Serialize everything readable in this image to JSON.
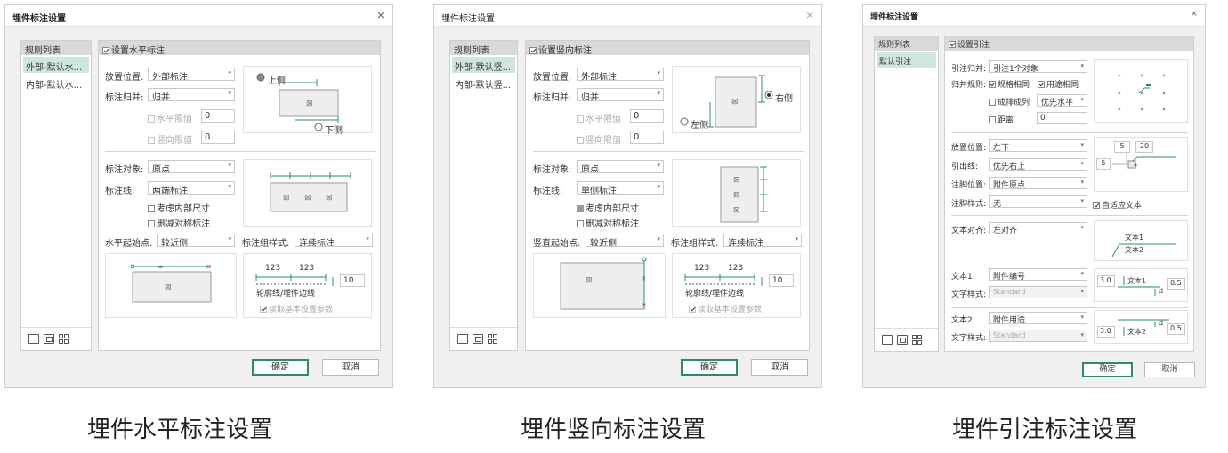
{
  "dialogs": [
    {
      "title": "埋件标注设置",
      "close": "×",
      "rules_header": "规则列表",
      "rules": [
        "外部-默认水...",
        "内部-默认水..."
      ],
      "section_check": "设置水平标注",
      "placement_label": "放置位置:",
      "placement_value": "外部标注",
      "merge_label": "标注归并:",
      "merge_value": "归并",
      "h_limit_label": "水平限值",
      "h_limit_value": "0",
      "v_limit_label": "竖向限值",
      "v_limit_value": "0",
      "side_a": "上侧",
      "side_b": "下侧",
      "target_label": "标注对象:",
      "target_value": "原点",
      "line_label": "标注线:",
      "line_value": "两端标注",
      "inner_dim": "考虑内部尺寸",
      "del_sym": "删减对称标注",
      "start_label": "水平起始点:",
      "start_value": "较近侧",
      "group_label": "标注组样式:",
      "group_value": "连续标注",
      "dim_num": "123",
      "contour": "轮廓线/埋件边线",
      "offset_value": "10",
      "read_basic": "读取基本设置参数",
      "ok": "确定",
      "cancel": "取消",
      "caption": "埋件水平标注设置"
    },
    {
      "title": "埋件标注设置",
      "close": "×",
      "rules_header": "规则列表",
      "rules": [
        "外部-默认竖...",
        "内部-默认竖..."
      ],
      "section_check": "设置竖向标注",
      "placement_label": "放置位置:",
      "placement_value": "外部标注",
      "merge_label": "标注归并:",
      "merge_value": "归并",
      "h_limit_label": "水平限值",
      "h_limit_value": "0",
      "v_limit_label": "竖向限值",
      "v_limit_value": "0",
      "side_a": "右侧",
      "side_b": "左侧",
      "target_label": "标注对象:",
      "target_value": "原点",
      "line_label": "标注线:",
      "line_value": "单侧标注",
      "inner_dim": "考虑内部尺寸",
      "del_sym": "删减对称标注",
      "start_label": "竖直起始点:",
      "start_value": "较近侧",
      "group_label": "标注组样式:",
      "group_value": "连续标注",
      "dim_num": "123",
      "contour": "轮廓线/埋件边线",
      "offset_value": "10",
      "read_basic": "读取基本设置参数",
      "ok": "确定",
      "cancel": "取消",
      "caption": "埋件竖向标注设置"
    },
    {
      "title": "埋件标注设置",
      "close": "×",
      "rules_header": "规则列表",
      "rules": [
        "默认引注"
      ],
      "section_check": "设置引注",
      "leader_merge_label": "引注归并:",
      "leader_merge_value": "引注1个对象",
      "merge_rule_label": "归并规则:",
      "same_spec": "规格相同",
      "same_use": "用途相同",
      "row_col": "成排成列",
      "priority_value": "优先水平",
      "distance": "距离",
      "distance_value": "0",
      "placement_label": "放置位置:",
      "placement_value": "左下",
      "leader_label": "引出线:",
      "leader_value": "优先右上",
      "foot_pos_label": "注脚位置:",
      "foot_pos_value": "附件原点",
      "foot_style_label": "注脚样式:",
      "foot_style_value": "无",
      "auto_text": "自适应文本",
      "preview_5a": "5",
      "preview_20": "20",
      "preview_5b": "5",
      "align_label": "文本对齐:",
      "align_value": "左对齐",
      "text1_preview": "文本1",
      "text2_preview": "文本2",
      "text1_label": "文本1",
      "text1_value": "附件编号",
      "style1_label": "文字样式:",
      "style1_value": "Standard",
      "t1_gap": "3.0",
      "t1_d": "d",
      "t1_off": "0.5",
      "text2_label": "文本2",
      "text2_value": "附件用途",
      "style2_label": "文字样式:",
      "style2_value": "Standard",
      "t2_gap": "3.0",
      "t2_d": "d",
      "t2_off": "0.5",
      "ok": "确定",
      "cancel": "取消",
      "caption": "埋件引注标注设置"
    }
  ]
}
